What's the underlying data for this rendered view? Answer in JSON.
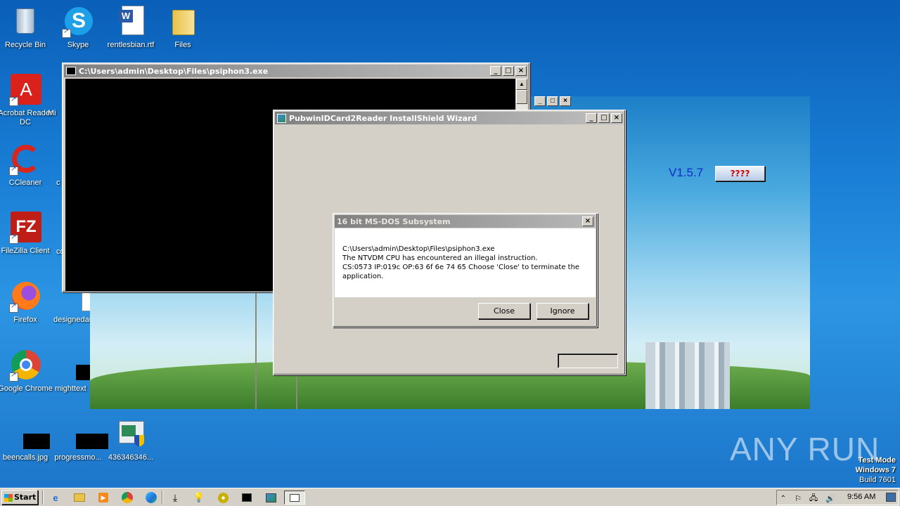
{
  "desktop": {
    "icons": [
      {
        "label": "Recycle Bin"
      },
      {
        "label": "Skype"
      },
      {
        "label": "rentlesbian.rtf"
      },
      {
        "label": "Files"
      },
      {
        "label": "Acrobat Reader DC"
      },
      {
        "label": "Mi"
      },
      {
        "label": "CCleaner"
      },
      {
        "label": "c"
      },
      {
        "label": "FileZilla Client"
      },
      {
        "label": "co"
      },
      {
        "label": "Firefox"
      },
      {
        "label": "designedau"
      },
      {
        "label": "Google Chrome"
      },
      {
        "label": "mighttext"
      },
      {
        "label": "beencalls.jpg"
      },
      {
        "label": "progressmo..."
      },
      {
        "label": "436346346..."
      }
    ],
    "watermark": {
      "brand": "ANY  RUN",
      "line1": "Test Mode",
      "line2": "Windows 7",
      "line3": "Build 7601"
    }
  },
  "console_window": {
    "title": "C:\\Users\\admin\\Desktop\\Files\\psiphon3.exe"
  },
  "installer_bg": {
    "version": "V1.5.7",
    "button_label": "????"
  },
  "wizard_window": {
    "title": "PubwinIDCard2Reader InstallShield Wizard"
  },
  "dialog": {
    "title": "16 bit MS-DOS Subsystem",
    "lines": [
      "C:\\Users\\admin\\Desktop\\Files\\psiphon3.exe",
      "The NTVDM CPU has encountered an illegal instruction.",
      "CS:0573 IP:019c OP:63 6f 6e 74 65 Choose 'Close' to terminate the",
      "application."
    ],
    "close_label": "Close",
    "ignore_label": "Ignore"
  },
  "taskbar": {
    "start_label": "Start",
    "clock": "9:56 AM"
  }
}
